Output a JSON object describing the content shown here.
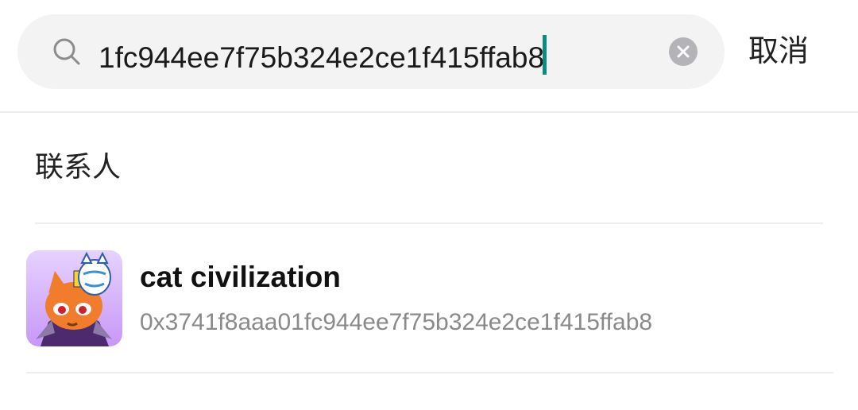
{
  "search": {
    "query": "1fc944ee7f75b324e2ce1f415ffab8",
    "search_icon": "search-icon",
    "clear_icon": "clear-icon"
  },
  "header": {
    "cancel_label": "取消"
  },
  "contacts": {
    "section_title": "联系人",
    "items": [
      {
        "name": "cat civilization",
        "address": "0x3741f8aaa01fc944ee7f75b324e2ce1f415ffab8",
        "avatar": "cat-avatar"
      }
    ]
  },
  "colors": {
    "caret": "#0c8c7c",
    "search_bg": "#f3f3f3",
    "avatar_bg": "#d4aefa"
  }
}
